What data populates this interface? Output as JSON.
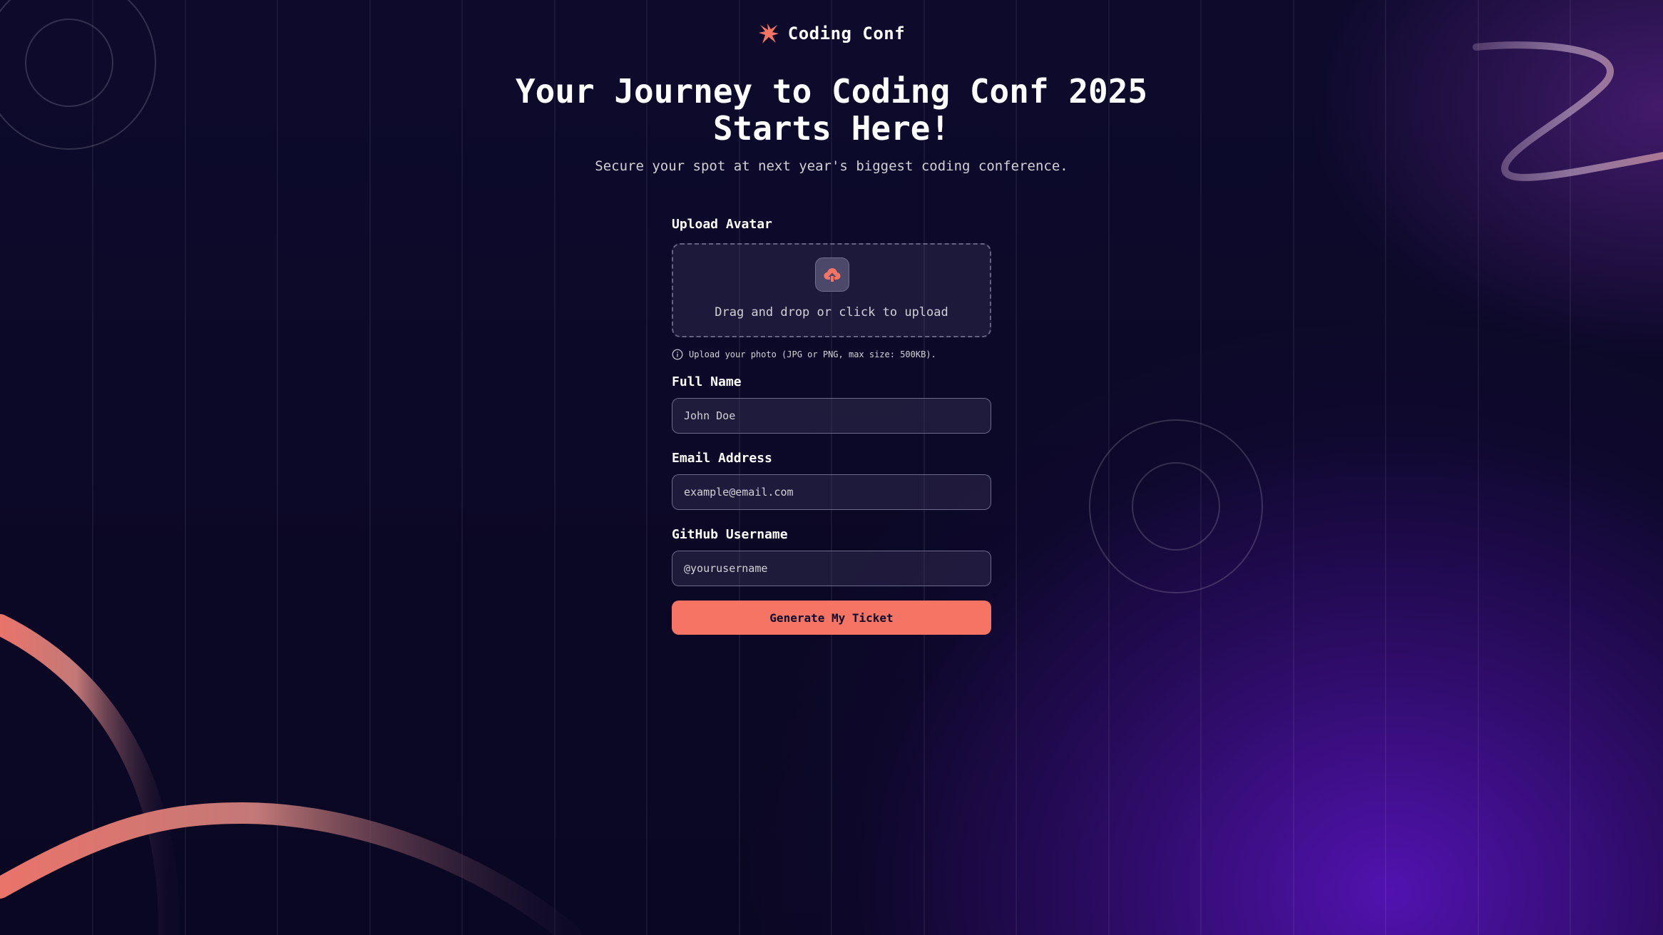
{
  "brand": {
    "name": "Coding Conf",
    "logo_icon": "coding-conf-logo-icon"
  },
  "hero": {
    "title": "Your Journey to Coding Conf 2025 Starts Here!",
    "subtitle": "Secure your spot at next year's biggest coding conference."
  },
  "form": {
    "avatar": {
      "label": "Upload Avatar",
      "dropzone_text": "Drag and drop or click to upload",
      "icon": "upload-cloud-icon",
      "hint": "Upload your photo (JPG or PNG, max size: 500KB).",
      "hint_icon": "info-icon"
    },
    "full_name": {
      "label": "Full Name",
      "placeholder": "John Doe"
    },
    "email": {
      "label": "Email Address",
      "placeholder": "example@email.com"
    },
    "github": {
      "label": "GitHub Username",
      "placeholder": "@yourusername"
    },
    "submit_label": "Generate My Ticket"
  },
  "colors": {
    "background": "#0b0727",
    "accent": "#f57463",
    "purple_glow": "#5e14c8",
    "text_muted": "#d2d1d6"
  }
}
